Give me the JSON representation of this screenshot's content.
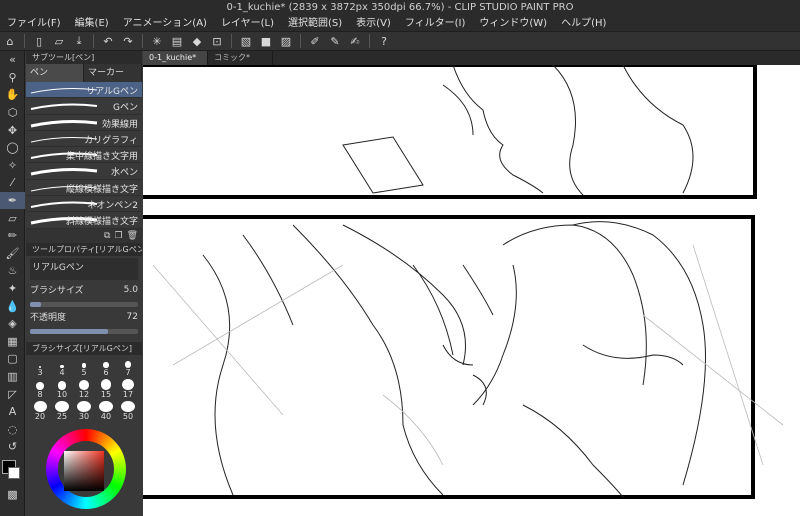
{
  "window": {
    "title": "0-1_kuchie* (2839 x 3872px 350dpi 66.7%)  - CLIP STUDIO PAINT PRO"
  },
  "menu": [
    "ファイル(F)",
    "編集(E)",
    "アニメーション(A)",
    "レイヤー(L)",
    "選択範囲(S)",
    "表示(V)",
    "フィルター(I)",
    "ウィンドウ(W)",
    "ヘルプ(H)"
  ],
  "subtool_panel": {
    "title": "サブツール[ペン]",
    "tabs": [
      "ペン",
      "マーカー"
    ],
    "brushes": [
      "リアルGペン",
      "Gペン",
      "効果線用",
      "カリグラフィ",
      "集中線描き文字用",
      "水ペン",
      "縦線模様描き文字",
      "ネオンペン2",
      "斜線模様描き文字"
    ]
  },
  "tool_property": {
    "title": "ツールプロパティ[リアルGペン]",
    "brush_name": "リアルGペン",
    "size_label": "ブラシサイズ",
    "size_value": "5.0",
    "opacity_label": "不透明度",
    "opacity_value": "72",
    "opacity_fraction": 0.72,
    "size_fraction": 0.1
  },
  "brush_size_panel": {
    "title": "ブラシサイズ[リアルGペン]",
    "top_row": [
      "3",
      "4",
      "5",
      "6",
      "7"
    ],
    "sizes": [
      "8",
      "10",
      "12",
      "15",
      "17",
      "20",
      "25",
      "30",
      "40",
      "50"
    ]
  },
  "canvas_tabs": [
    "0-1_kuchie*",
    "コミック*"
  ],
  "colors": {
    "accent": "#4c6286",
    "main_color": "#000000",
    "sub_color": "#ffffff"
  }
}
